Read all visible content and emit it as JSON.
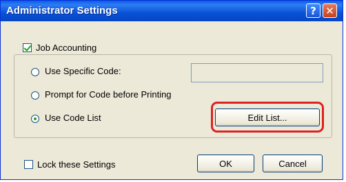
{
  "window": {
    "title": "Administrator Settings",
    "help_glyph": "?",
    "close_glyph": "✕"
  },
  "group": {
    "job_accounting": {
      "label": "Job Accounting",
      "checked": true
    }
  },
  "options": {
    "use_specific_code": {
      "label": "Use Specific Code:",
      "selected": false,
      "value": ""
    },
    "prompt_for_code": {
      "label": "Prompt for Code before Printing",
      "selected": false
    },
    "use_code_list": {
      "label": "Use Code List",
      "selected": true
    }
  },
  "buttons": {
    "edit_list": "Edit List...",
    "ok": "OK",
    "cancel": "Cancel"
  },
  "lock_settings": {
    "label": "Lock these Settings",
    "checked": false
  },
  "colors": {
    "titlebar": "#0a5ee8",
    "highlight": "#e02020",
    "dialog_bg": "#ece9d8"
  },
  "icons": {
    "help": "help-icon",
    "close": "close-icon"
  }
}
